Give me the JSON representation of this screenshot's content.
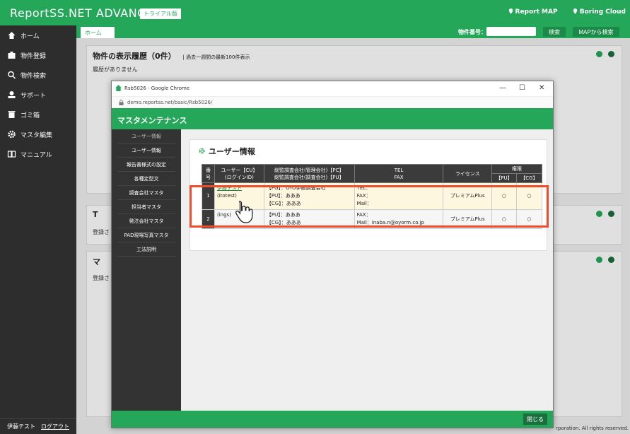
{
  "app": {
    "title": "ReportSS.NET ADVANCE",
    "trial_badge": "トライアル版",
    "report_map": "Report MAP",
    "boring_cloud": "Boring Cloud"
  },
  "sidebar": {
    "items": [
      {
        "label": "ホーム",
        "icon": "home-icon"
      },
      {
        "label": "物件登録",
        "icon": "building-icon"
      },
      {
        "label": "物件検索",
        "icon": "search-icon"
      },
      {
        "label": "サポート",
        "icon": "user-icon"
      },
      {
        "label": "ゴミ箱",
        "icon": "trash-icon"
      },
      {
        "label": "マスタ編集",
        "icon": "gear-icon"
      },
      {
        "label": "マニュアル",
        "icon": "book-icon"
      }
    ],
    "user_name": "伊藤テスト",
    "logout": "ログアウト"
  },
  "tabs": {
    "home": "ホーム",
    "search_label": "物件番号：",
    "search_placeholder": "",
    "search_button": "検索",
    "map_button": "MAPから検索"
  },
  "panels": {
    "history_title": "物件の表示履歴（0件）",
    "history_subtitle": "| 過去一週間の最新100件表示",
    "history_body": "履歴がありません",
    "panel2_title": "T",
    "panel2_body": "登録さ",
    "panel3_title": "マ",
    "panel3_body": "登録さ",
    "copyright": "rporation. All rights reserved."
  },
  "popup": {
    "window_title": "Rsb5026 - Google Chrome",
    "url": "demo.reportss.net/basic/Rsb5026/",
    "header": "マスタメンテナンス",
    "menu": [
      "ユーザー情報",
      "ユーザー情報",
      "報告書様式の設定",
      "各種定型文",
      "調査会社マスタ",
      "担当者マスタ",
      "発注会社マスタ",
      "PAD現場写真マスタ",
      "工法説明"
    ],
    "section_title": "ユーザー情報",
    "table": {
      "headers": {
        "num": "番号",
        "user": "ユーザー【CU】\n(ログインID)",
        "company": "総監調査会社(管理会社)【PC】\n総監調査会社(調査会社)【PU】",
        "tel": "TEL\nFAX",
        "license": "ライセンス",
        "perm": "権限",
        "pu": "【PU】",
        "cg": "【CG】"
      },
      "rows": [
        {
          "num": "1",
          "user": "伊藤テスト",
          "login": "(itotest)",
          "pc": "【PG】：OYO伊藤調査会社",
          "pu": "【PU】：あああ",
          "cg": "【CG】：あああ",
          "tel": "TEL：",
          "fax": "FAX：",
          "mail": "Mail：",
          "license": "プレミアムPlus",
          "perm_pu": "○",
          "perm_cg": "○"
        },
        {
          "num": "2",
          "user": "(ings)",
          "pc": "",
          "pu": "【PU】：あああ",
          "cg": "【CG】：あああ",
          "fax": "FAX：",
          "mail": "Mail：inaba.n@oyorm.co.jp",
          "license": "プレミアムPlus",
          "perm_pu": "○",
          "perm_cg": "○"
        }
      ]
    },
    "close_button": "閉じる"
  },
  "colors": {
    "brand_green": "#25a75a",
    "dark": "#2d2d2d",
    "highlight": "#ef4b2c"
  }
}
